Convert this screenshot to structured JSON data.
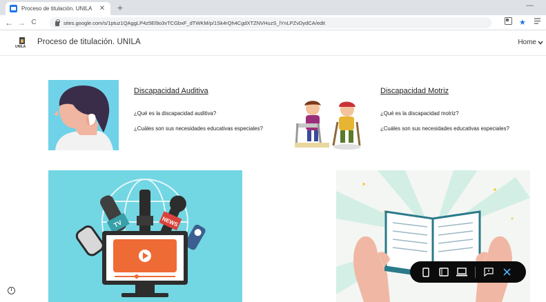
{
  "browser": {
    "tab_title": "Proceso de titulación. UNILA",
    "tab_close": "✕",
    "new_tab": "+",
    "window_minimize": "—",
    "url": "sites.google.com/s/1ptuz1QAggLP4z5El9o3vTCGbxF_dTWKM/p/1Sk4rQh4CgdXTZNVHuzS_lYnLPZvDydCA/edit",
    "nav": {
      "back": "←",
      "forward": "→",
      "reload": "C"
    }
  },
  "site": {
    "logo_text": "UNILA",
    "title": "Proceso de titulación. UNILA",
    "nav_home": "Home",
    "nav_chevron": "⌄"
  },
  "cards": [
    {
      "title": "Discapacidad Auditiva",
      "questions": [
        "¿Qué es la discapacidad auditiva?",
        "¿Cuáles son sus necesidades educativas especiales?"
      ]
    },
    {
      "title": "Discapacidad Motriz",
      "questions": [
        "¿Qué es la discapacidad motriz?",
        "¿Cuáles son sus necesidades educativas especiales?"
      ]
    }
  ],
  "media_banner": {
    "tv_label": "TV",
    "news_label": "NEWS"
  },
  "preview_toolbar": {
    "icons": [
      "phone-icon",
      "tablet-icon",
      "laptop-icon",
      "feedback-icon",
      "close-icon"
    ],
    "accent": "#4fb3ff"
  },
  "colors": {
    "auditiva_bg": "#6fd2e8",
    "media_bg": "#72d6e3",
    "accent_blue": "#1a73e8"
  }
}
